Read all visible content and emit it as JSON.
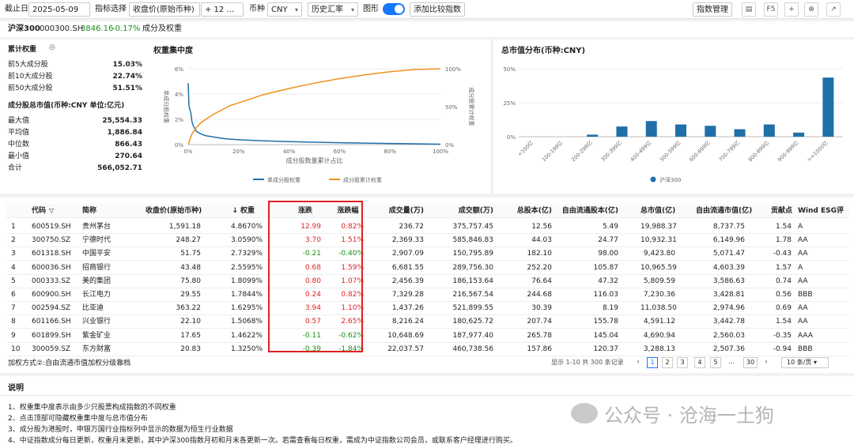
{
  "toolbar": {
    "date_label": "截止日",
    "date_value": "2025-05-09",
    "indicator_label": "指标选择",
    "indicator_value": "收盘价(原始币种)",
    "indicator_extra": "+ 12 ...",
    "currency_label": "币种",
    "currency_value": "CNY",
    "rate_value": "历史汇率",
    "chart_label": "图形",
    "add_compare": "添加比较指数",
    "index_manage": "指数管理",
    "f5": "F5"
  },
  "header": {
    "name": "沪深300",
    "code": "000300.SH",
    "price": "3846.16",
    "change": "-0.17%",
    "tab": "成分及权重"
  },
  "weights": {
    "title": "累计权重",
    "rows": [
      {
        "label": "前5大成分股",
        "value": "15.03%"
      },
      {
        "label": "前10大成分股",
        "value": "22.74%"
      },
      {
        "label": "前50大成分股",
        "value": "51.51%"
      }
    ]
  },
  "mcap": {
    "title": "成分股总市值(币种:CNY 单位:亿元)",
    "rows": [
      {
        "label": "最大值",
        "value": "25,554.33"
      },
      {
        "label": "平均值",
        "value": "1,886.84"
      },
      {
        "label": "中位数",
        "value": "866.43"
      },
      {
        "label": "最小值",
        "value": "270.64"
      },
      {
        "label": "合计",
        "value": "566,052.71"
      }
    ]
  },
  "chart_data": [
    {
      "type": "line",
      "title": "权重集中度",
      "xlabel": "成分股数量累计占比",
      "ylabel": "单成分股权重",
      "y2label": "成分股累计权重",
      "xticks": [
        "0%",
        "20%",
        "40%",
        "60%",
        "80%",
        "100%"
      ],
      "yticks": [
        "0%",
        "2%",
        "4%",
        "6%"
      ],
      "y2ticks": [
        "0%",
        "50%",
        "100%"
      ],
      "xlim": [
        0,
        100
      ],
      "ylim": [
        0,
        6
      ],
      "y2lim": [
        0,
        100
      ],
      "series": [
        {
          "name": "单成分股权重",
          "color": "#1f6fa8",
          "x": [
            0,
            0.3,
            0.7,
            1,
            1.5,
            2,
            3,
            4,
            5,
            7,
            10,
            15,
            20,
            30,
            40,
            50,
            60,
            70,
            80,
            90,
            100
          ],
          "y": [
            4.87,
            3.06,
            2.73,
            2.56,
            1.8,
            1.5,
            1.1,
            0.95,
            0.85,
            0.7,
            0.6,
            0.45,
            0.38,
            0.3,
            0.24,
            0.19,
            0.15,
            0.12,
            0.09,
            0.06,
            0.03
          ]
        },
        {
          "name": "成分股累计权重",
          "color": "#f0911e",
          "x": [
            0,
            1,
            1.67,
            3.33,
            5,
            10,
            16.7,
            20,
            30,
            40,
            50,
            60,
            70,
            80,
            90,
            100
          ],
          "y": [
            0,
            10,
            15.03,
            22.74,
            29,
            40,
            51.51,
            55,
            66,
            74,
            81,
            87,
            92,
            96,
            99,
            100
          ]
        }
      ]
    },
    {
      "type": "bar",
      "title": "总市值分布(币种:CNY)",
      "categories": [
        "<100亿",
        "100-199亿",
        "200-299亿",
        "300-399亿",
        "400-499亿",
        "500-599亿",
        "600-699亿",
        "700-799亿",
        "800-899亿",
        "900-999亿",
        ">=1000亿"
      ],
      "yticks": [
        "0%",
        "25%",
        "50%"
      ],
      "ylim": [
        0,
        50
      ],
      "values": [
        0,
        0,
        1.5,
        7.5,
        11.5,
        9,
        8,
        5.5,
        9,
        3,
        43.5
      ],
      "series_name": "沪深300",
      "color": "#1f6fa8"
    }
  ],
  "table": {
    "headers": [
      "代码",
      "简称",
      "收盘价(原始币种)",
      "↓ 权重",
      "涨跌",
      "涨跌幅",
      "成交量(万)",
      "成交额(万)",
      "总股本(亿)",
      "自由流通股本(亿)",
      "总市值(亿)",
      "自由流通市值(亿)",
      "贡献点",
      "Wind ESG评"
    ],
    "rows": [
      [
        "1",
        "600519.SH",
        "贵州茅台",
        "1,591.18",
        "4.8670%",
        "12.99",
        "0.82%",
        "236.72",
        "375,757.45",
        "12.56",
        "5.49",
        "19,988.37",
        "8,737.75",
        "1.54",
        "A"
      ],
      [
        "2",
        "300750.SZ",
        "宁德时代",
        "248.27",
        "3.0590%",
        "3.70",
        "1.51%",
        "2,369.33",
        "585,846.83",
        "44.03",
        "24.77",
        "10,932.31",
        "6,149.96",
        "1.78",
        "AA"
      ],
      [
        "3",
        "601318.SH",
        "中国平安",
        "51.75",
        "2.7329%",
        "-0.21",
        "-0.40%",
        "2,907.09",
        "150,795.89",
        "182.10",
        "98.00",
        "9,423.80",
        "5,071.47",
        "-0.43",
        "AA"
      ],
      [
        "4",
        "600036.SH",
        "招商银行",
        "43.48",
        "2.5595%",
        "0.68",
        "1.59%",
        "6,681.55",
        "289,756.30",
        "252.20",
        "105.87",
        "10,965.59",
        "4,603.39",
        "1.57",
        "A"
      ],
      [
        "5",
        "000333.SZ",
        "美的集团",
        "75.80",
        "1.8099%",
        "0.80",
        "1.07%",
        "2,456.39",
        "186,153.64",
        "76.64",
        "47.32",
        "5,809.59",
        "3,586.63",
        "0.74",
        "AA"
      ],
      [
        "6",
        "600900.SH",
        "长江电力",
        "29.55",
        "1.7844%",
        "0.24",
        "0.82%",
        "7,329.28",
        "216,567.54",
        "244.68",
        "116.03",
        "7,230.36",
        "3,428.81",
        "0.56",
        "BBB"
      ],
      [
        "7",
        "002594.SZ",
        "比亚迪",
        "363.22",
        "1.6295%",
        "3.94",
        "1.10%",
        "1,437.26",
        "521,899.55",
        "30.39",
        "8.19",
        "11,038.50",
        "2,974.96",
        "0.69",
        "AA"
      ],
      [
        "8",
        "601166.SH",
        "兴业银行",
        "22.10",
        "1.5068%",
        "0.57",
        "2.65%",
        "8,216.24",
        "180,625.72",
        "207.74",
        "155.78",
        "4,591.12",
        "3,442.78",
        "1.54",
        "AA"
      ],
      [
        "9",
        "601899.SH",
        "紫金矿业",
        "17.65",
        "1.4622%",
        "-0.11",
        "-0.62%",
        "10,648.69",
        "187,977.40",
        "265.78",
        "145.04",
        "4,690.94",
        "2,560.03",
        "-0.35",
        "AAA"
      ],
      [
        "10",
        "300059.SZ",
        "东方财富",
        "20.83",
        "1.3250%",
        "-0.39",
        "-1.84%",
        "22,037.57",
        "460,738.56",
        "157.86",
        "120.37",
        "3,288.13",
        "2,507.36",
        "-0.94",
        "BBB"
      ]
    ]
  },
  "footer": {
    "method": "加权方式②:自由流通市值加权分级靠档",
    "summary": "显示 1-10 共 300 条记录",
    "pages": [
      "1",
      "2",
      "3",
      "4",
      "5",
      "...",
      "30"
    ],
    "per_page": "10 条/页"
  },
  "notes": {
    "title": "说明",
    "items": [
      "1、权重集中度表示由多少只股票构成指数的不同权重",
      "2、点击顶部可隐藏权重集中度与总市值分布",
      "3、成分股为港股时，申银万国行业指标列中显示的数据为恒生行业数据",
      "4、中证指数成分每日更新，权重月末更新，其中沪深300指数月初和月末各更新一次。若需查看每日权重，需成为中证指数公司会员，或联系客户经理进行购买。"
    ]
  },
  "watermark": "公众号 · 沧海一土狗"
}
